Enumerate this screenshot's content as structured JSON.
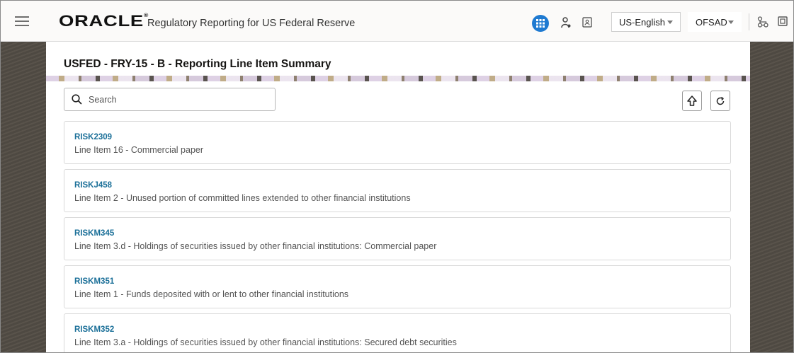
{
  "header": {
    "logo_text": "ORACLE",
    "logo_mark": "®",
    "app_title": "Regulatory Reporting for US Federal Reserve",
    "language": "US-English",
    "user": "OFSAD",
    "icons": [
      "hamburger-icon",
      "apps-grid-icon",
      "person-icon",
      "id-card-icon",
      "tree-icon",
      "calendar-icon"
    ]
  },
  "page": {
    "title": "USFED - FRY-15 - B - Reporting Line Item Summary"
  },
  "search": {
    "placeholder": "Search",
    "value": ""
  },
  "toolbar": {
    "upload_icon": "upload-arrow-icon",
    "refresh_icon": "refresh-icon"
  },
  "items": [
    {
      "code": "RISK2309",
      "description": "Line Item 16 - Commercial paper"
    },
    {
      "code": "RISKJ458",
      "description": "Line Item 2 - Unused portion of committed lines extended to other financial institutions"
    },
    {
      "code": "RISKM345",
      "description": "Line Item 3.d - Holdings of securities issued by other financial institutions: Commercial paper"
    },
    {
      "code": "RISKM351",
      "description": "Line Item 1 - Funds deposited with or lent to other financial institutions"
    },
    {
      "code": "RISKM352",
      "description": "Line Item 3.a - Holdings of securities issued by other financial institutions: Secured debt securities"
    }
  ],
  "colors": {
    "accent": "#1f7ad1",
    "link": "#1a6f98",
    "sidebar": "#4e4942"
  }
}
